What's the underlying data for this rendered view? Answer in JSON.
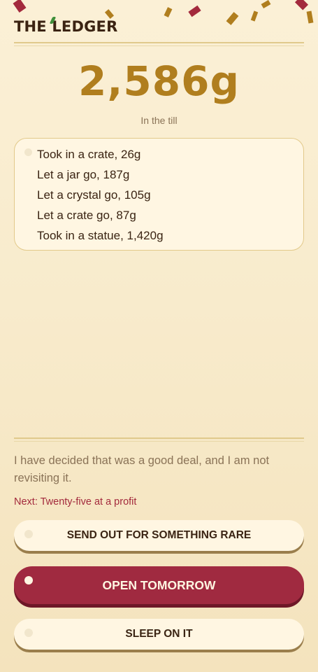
{
  "header": {
    "logo": "THE LEDGER"
  },
  "balance": {
    "amount": "2,586g",
    "label": "In the till"
  },
  "log": {
    "entries": [
      "Took in a crate, 26g",
      "Let a jar go, 187g",
      "Let a crystal go, 105g",
      "Let a crate go, 87g",
      "Took in a statue, 1,420g"
    ]
  },
  "message": {
    "quote": "I have decided that was a good deal, and I am not revisiting it.",
    "next": "Next: Twenty-five at a profit"
  },
  "actions": {
    "send_out": "SEND OUT FOR SOMETHING RARE",
    "open_tomorrow": "OPEN TOMORROW",
    "sleep": "SLEEP ON IT"
  },
  "colors": {
    "accent": "#b07e1e",
    "primary_button": "#a02a40",
    "background": "#fbf0d6"
  }
}
